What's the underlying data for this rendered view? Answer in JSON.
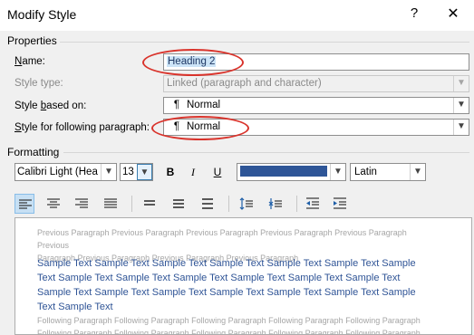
{
  "window": {
    "title": "Modify Style",
    "help_label": "?",
    "close_label": "✕"
  },
  "properties": {
    "section_label": "Properties",
    "name": {
      "label": "Name:",
      "value": "Heading 2"
    },
    "style_type": {
      "label": "Style type:",
      "value": "Linked (paragraph and character)"
    },
    "style_based_on": {
      "label_prefix": "Style ",
      "label_mnemonic": "b",
      "label_suffix": "ased on:",
      "value": "Normal"
    },
    "following": {
      "label_mnemonic": "S",
      "label_suffix": "tyle for following paragraph:",
      "value": "Normal"
    },
    "pilcrow": "¶"
  },
  "formatting": {
    "section_label": "Formatting",
    "font_name": "Calibri Light (Hea",
    "font_size": "13",
    "bold_label": "B",
    "italic_label": "I",
    "underline_label": "U",
    "font_color": "#2e5597",
    "language": "Latin"
  },
  "alignment_buttons": [
    {
      "name": "align-left-button",
      "active": true
    },
    {
      "name": "align-center-button",
      "active": false
    },
    {
      "name": "align-right-button",
      "active": false
    },
    {
      "name": "justify-button",
      "active": false
    },
    {
      "name": "single-spacing-button",
      "active": false
    },
    {
      "name": "one-half-spacing-button",
      "active": false
    },
    {
      "name": "double-spacing-button",
      "active": false
    },
    {
      "name": "increase-paragraph-spacing-button",
      "active": false
    },
    {
      "name": "decrease-paragraph-spacing-button",
      "active": false
    },
    {
      "name": "decrease-indent-button",
      "active": false
    },
    {
      "name": "increase-indent-button",
      "active": false
    }
  ],
  "preview": {
    "previous_line1": "Previous Paragraph Previous Paragraph Previous Paragraph Previous Paragraph Previous Paragraph Previous",
    "previous_line2": "Paragraph Previous Paragraph Previous Paragraph Previous Paragraph",
    "sample_line1": "Sample Text Sample Text Sample Text Sample Text Sample Text Sample Text Sample",
    "sample_line2": "Text Sample Text Sample Text Sample Text Sample Text Sample Text Sample Text",
    "sample_line3": "Sample Text Sample Text Sample Text Sample Text Sample Text Sample Text Sample",
    "sample_line4": "Text Sample Text",
    "following_line1": "Following Paragraph Following Paragraph Following Paragraph Following Paragraph Following Paragraph",
    "following_line2": "Following Paragraph Following Paragraph Following Paragraph Following Paragraph Following Paragraph"
  },
  "colors": {
    "highlight_ring": "#d9332b",
    "selection": "#cce4f7",
    "heading_blue": "#2f5496"
  }
}
